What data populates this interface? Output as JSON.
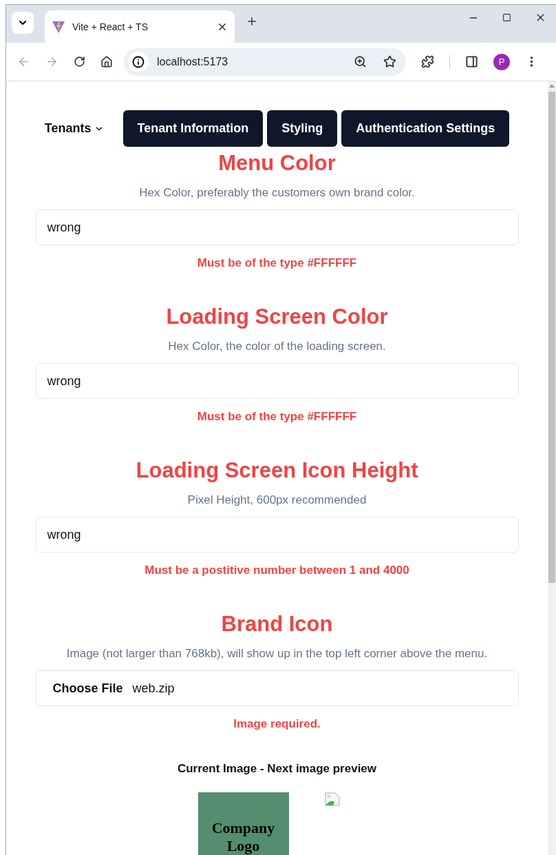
{
  "browser": {
    "tab_title": "Vite + React + TS",
    "url": "localhost:5173",
    "profile_initial": "P"
  },
  "nav": {
    "dropdown": "Tenants",
    "buttons": [
      "Tenant Information",
      "Styling",
      "Authentication Settings"
    ]
  },
  "sections": [
    {
      "kind": "text",
      "title": "Menu Color",
      "hint": "Hex Color, preferably the customers own brand color.",
      "value": "wrong",
      "error": "Must be of the type #FFFFFF"
    },
    {
      "kind": "text",
      "title": "Loading Screen Color",
      "hint": "Hex Color, the color of the loading screen.",
      "value": "wrong",
      "error": "Must be of the type #FFFFFF"
    },
    {
      "kind": "text",
      "title": "Loading Screen Icon Height",
      "hint": "Pixel Height, 600px recommended",
      "value": "wrong",
      "error": "Must be a postitive number between 1 and 4000"
    },
    {
      "kind": "file",
      "title": "Brand Icon",
      "hint": "Image (not larger than 768kb), will show up in the top left corner above the menu.",
      "button_label": "Choose File",
      "filename": "web.zip",
      "error": "Image required."
    }
  ],
  "preview": {
    "caption": "Current Image - Next image preview",
    "current_image_text": "Company Logo"
  }
}
